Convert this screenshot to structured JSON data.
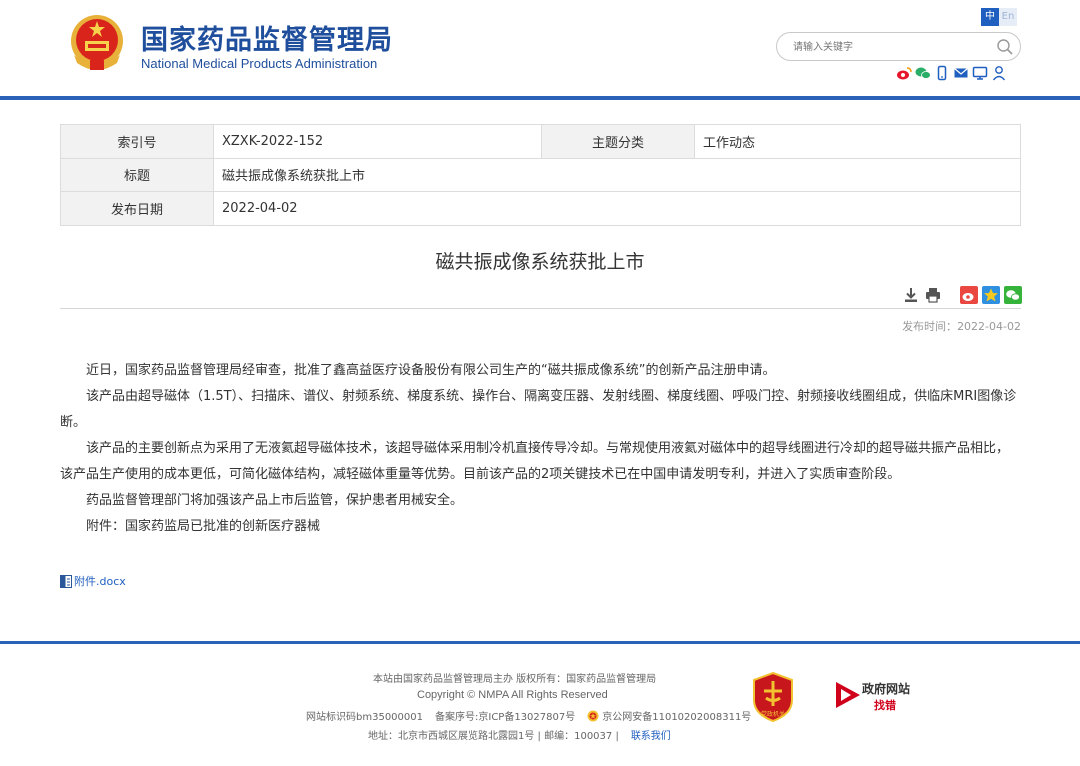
{
  "header": {
    "logo_cn": "国家药品监督管理局",
    "logo_en": "National Medical Products Administration",
    "lang_zh": "中",
    "lang_en": "En",
    "search_placeholder": "请输入关键字"
  },
  "meta": {
    "index_label": "索引号",
    "index_value": "XZXK-2022-152",
    "category_label": "主题分类",
    "category_value": "工作动态",
    "title_label": "标题",
    "title_value": "磁共振成像系统获批上市",
    "date_label": "发布日期",
    "date_value": "2022-04-02"
  },
  "article": {
    "title": "磁共振成像系统获批上市",
    "pubtime_label": "发布时间：",
    "pubtime_value": "2022-04-02",
    "paragraphs": [
      "近日，国家药品监督管理局经审查，批准了鑫高益医疗设备股份有限公司生产的“磁共振成像系统”的创新产品注册申请。",
      "该产品由超导磁体（1.5T）、扫描床、谱仪、射频系统、梯度系统、操作台、隔离变压器、发射线圈、梯度线圈、呼吸门控、射频接收线圈组成，供临床MRI图像诊断。",
      "该产品的主要创新点为采用了无液氦超导磁体技术，该超导磁体采用制冷机直接传导冷却。与常规使用液氦对磁体中的超导线圈进行冷却的超导磁共振产品相比，该产品生产使用的成本更低，可简化磁体结构，减轻磁体重量等优势。目前该产品的2项关键技术已在中国申请发明专利，并进入了实质审查阶段。",
      "药品监督管理部门将加强该产品上市后监管，保护患者用械安全。",
      "附件：国家药监局已批准的创新医疗器械"
    ],
    "attachment": "附件.docx"
  },
  "footer": {
    "line1": "本站由国家药品监督管理局主办 版权所有：国家药品监督管理局",
    "line2": "Copyright © NMPA All Rights Reserved",
    "site_id": "网站标识码bm35000001",
    "icp": "备案序号:京ICP备13027807号",
    "police": "京公网安备11010202008311号",
    "address": "地址：北京市西城区展览路北露园1号 | 邮编：100037 |",
    "contact": "联系我们",
    "gov_badge_t1": "政府网站",
    "gov_badge_t2": "找错",
    "party_badge": "党政机关"
  },
  "colors": {
    "brand_blue": "#1f4e9c",
    "bar_blue": "#2a62b8",
    "link_blue": "#1f5fbf"
  }
}
